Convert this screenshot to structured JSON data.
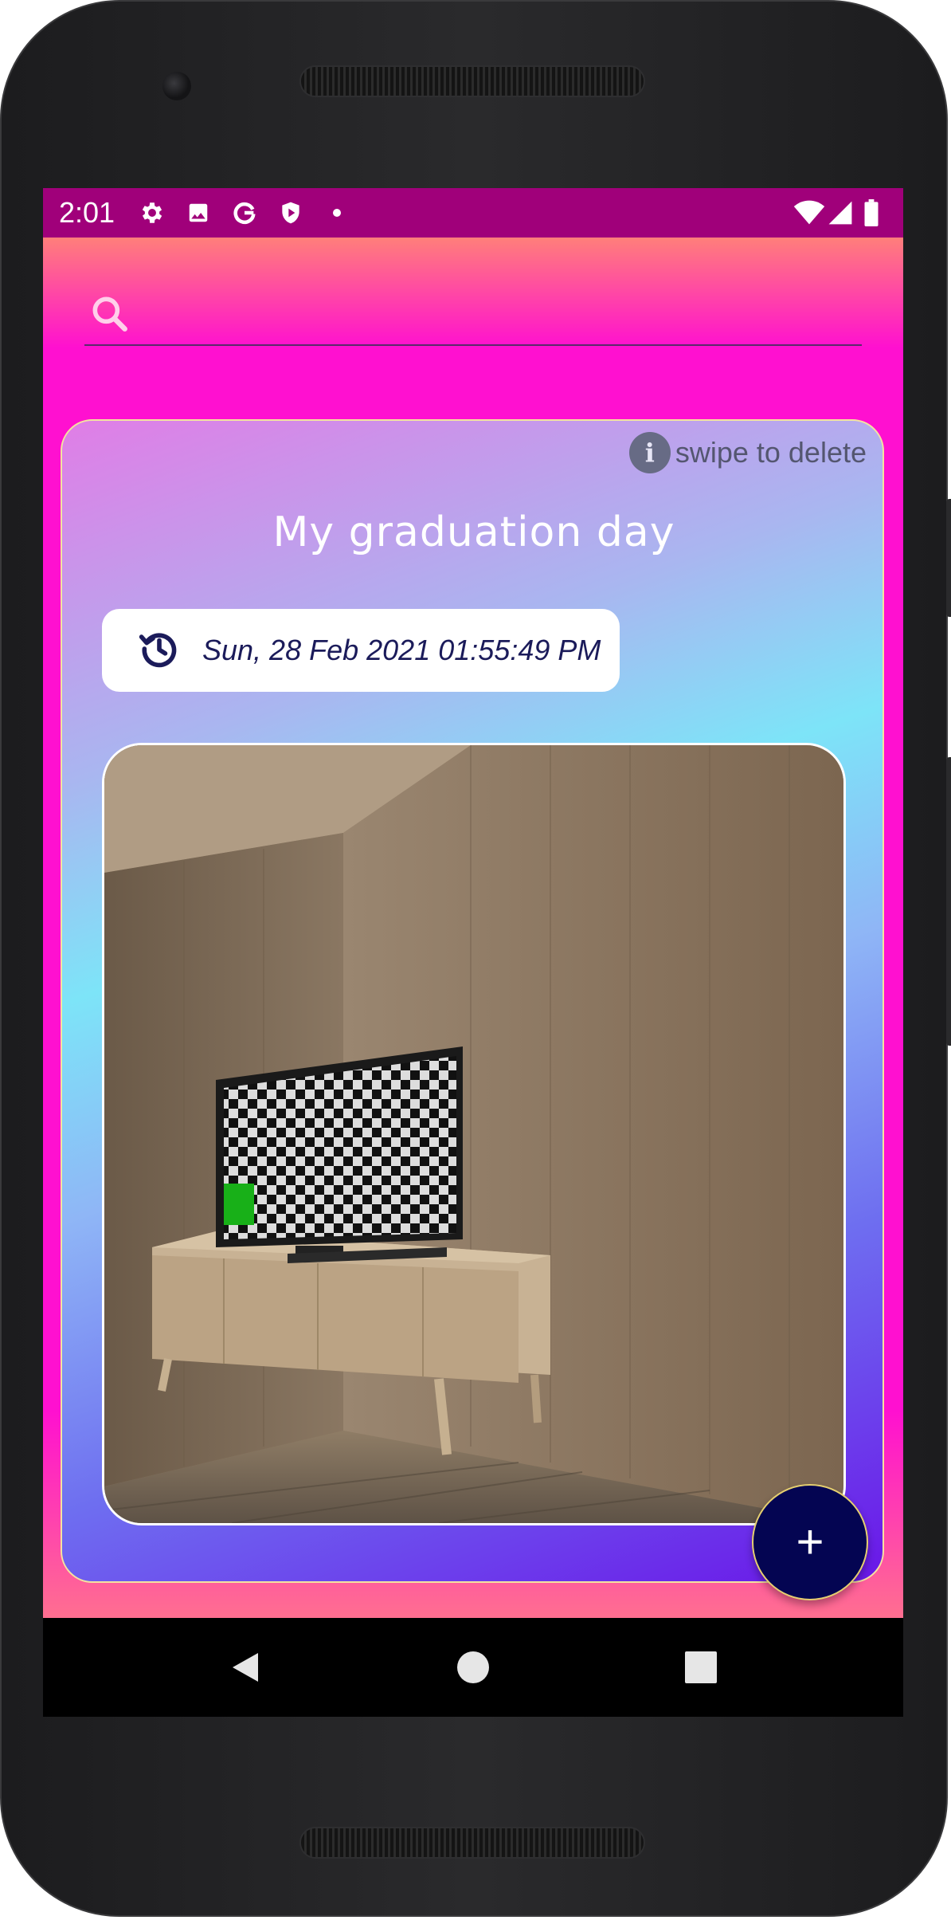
{
  "status_bar": {
    "time": "2:01",
    "icons": [
      "gear-icon",
      "image-icon",
      "google-icon",
      "shield-play-icon",
      "dot-icon"
    ],
    "right_icons": [
      "wifi-icon",
      "cell-signal-icon",
      "battery-icon"
    ]
  },
  "search": {
    "placeholder": "",
    "value": ""
  },
  "card": {
    "hint_text": "swipe to delete",
    "title": "My graduation day",
    "date": "Sun, 28 Feb 2021 01:55:49 PM"
  },
  "fab": {
    "label": "+"
  },
  "colors": {
    "status_bar": "#a0007a",
    "fab": "#040552",
    "accent_pink": "#ff10d0"
  }
}
